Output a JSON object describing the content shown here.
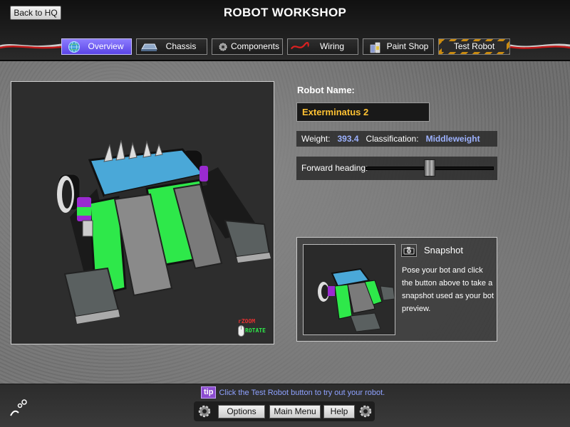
{
  "header": {
    "back_label": "Back to HQ",
    "title": "ROBOT WORKSHOP"
  },
  "tabs": [
    {
      "label": "Overview",
      "icon": "globe-icon",
      "active": true
    },
    {
      "label": "Chassis",
      "icon": "chassis-icon",
      "active": false
    },
    {
      "label": "Components",
      "icon": "gear-icon",
      "active": false
    },
    {
      "label": "Wiring",
      "icon": "wire-icon",
      "active": false
    },
    {
      "label": "Paint Shop",
      "icon": "paint-can-icon",
      "active": false
    },
    {
      "label": "Test Robot",
      "icon": "hazard-stripe",
      "active": false
    }
  ],
  "viewport": {
    "zoom_hint": "ZOOM",
    "rotate_hint": "ROTATE"
  },
  "robot": {
    "name_label": "Robot Name:",
    "name_value": "Exterminatus 2",
    "weight_label": "Weight:",
    "weight_value": "393.4",
    "class_label": "Classification:",
    "class_value": "Middleweight",
    "heading_label": "Forward heading:",
    "heading_fraction": 0.5
  },
  "snapshot": {
    "title": "Snapshot",
    "description": "Pose your bot and click the button above to take a snapshot used as your bot preview."
  },
  "footer": {
    "tip_badge": "tip",
    "tip_text": "Click the Test Robot button to try out your robot.",
    "options_label": "Options",
    "main_menu_label": "Main Menu",
    "help_label": "Help"
  },
  "colors": {
    "accent": "#6a54f0",
    "name_text": "#ffc233",
    "value_text": "#9db2ff",
    "armor_green": "#2ee84a",
    "armor_blue": "#4aa8d8"
  }
}
